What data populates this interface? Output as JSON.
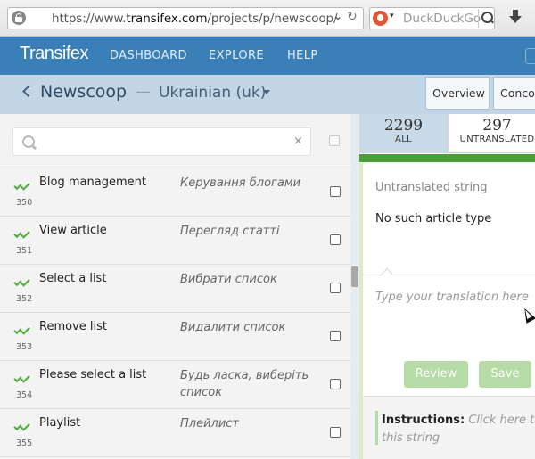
{
  "browser": {
    "url_host_prefix": "https://www.",
    "url_host": "transifex.com",
    "url_path": "/projects/p/newscoop/",
    "search_placeholder": "DuckDuckGo"
  },
  "nav": {
    "brand": "Transifex",
    "dashboard": "DASHBOARD",
    "explore": "EXPLORE",
    "help": "HELP"
  },
  "header": {
    "project": "Newscoop",
    "separator": "—",
    "language": "Ukrainian (uk)",
    "tabs": {
      "overview": "Overview",
      "concordance": "Concor"
    }
  },
  "filter": {
    "placeholder": "",
    "clear_glyph": "×"
  },
  "strings": [
    {
      "num": "350",
      "source": "Blog management",
      "translation": "Керування блогами"
    },
    {
      "num": "351",
      "source": "View article",
      "translation": "Перегляд статті"
    },
    {
      "num": "352",
      "source": "Select a list",
      "translation": "Вибрати список"
    },
    {
      "num": "353",
      "source": "Remove list",
      "translation": "Видалити список"
    },
    {
      "num": "354",
      "source": "Please select a list",
      "translation": "Будь ласка, виберіть список"
    },
    {
      "num": "355",
      "source": "Playlist",
      "translation": "Плейлист"
    }
  ],
  "stats": {
    "all_count": "2299",
    "all_label": "ALL",
    "untranslated_count": "297",
    "untranslated_label": "UNTRANSLATED"
  },
  "editor": {
    "status_label": "Untranslated string",
    "source_text": "No such article type",
    "translation_placeholder": "Type your translation here",
    "review_button": "Review",
    "save_button": "Save",
    "instructions_label": "Instructions:",
    "instructions_hint_line1": "Click here to a",
    "instructions_hint_line2": "this string"
  },
  "colors": {
    "nav_bg": "#3a7fb8",
    "subheader_bg": "#c3d6e5",
    "progress_green": "#4aa038",
    "check_green": "#4fae3b",
    "button_green_disabled": "#b6dba6"
  }
}
